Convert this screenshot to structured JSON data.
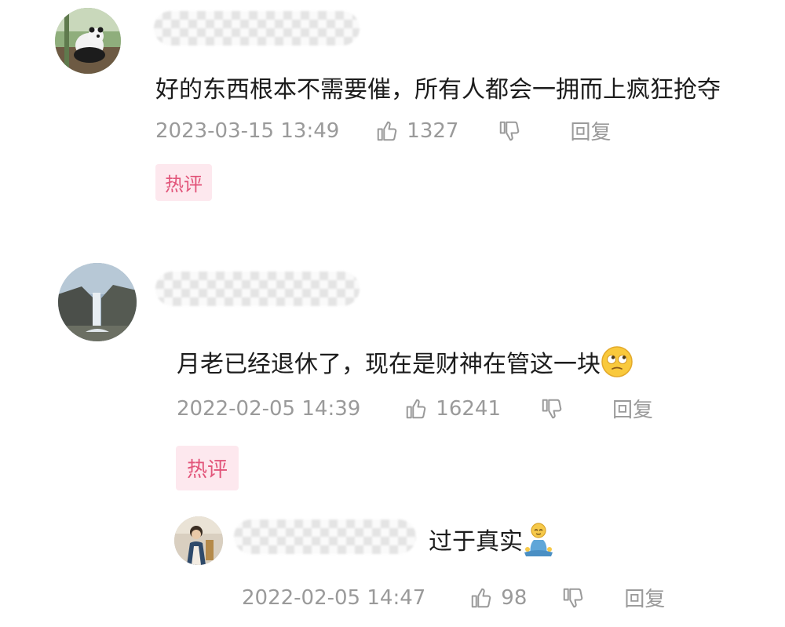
{
  "comments": [
    {
      "text": "好的东西根本不需要催，所有人都会一拥而上疯狂抢夺",
      "time": "2023-03-15 13:49",
      "likes": "1327",
      "reply_label": "回复",
      "badge": "热评",
      "avatar": "panda-photo"
    },
    {
      "text": "月老已经退休了，现在是财神在管这一块",
      "emoji": "rolling-eyes-face",
      "time": "2022-02-05 14:39",
      "likes": "16241",
      "reply_label": "回复",
      "badge": "热评",
      "avatar": "waterfall-photo"
    }
  ],
  "reply": {
    "text": "过于真实",
    "emoji": "meditating-person",
    "time": "2022-02-05 14:47",
    "likes": "98",
    "reply_label": "回复",
    "avatar": "person-photo"
  },
  "colors": {
    "badge_bg": "#fde8ee",
    "badge_text": "#e2557a",
    "meta_text": "#9a9a9a"
  }
}
